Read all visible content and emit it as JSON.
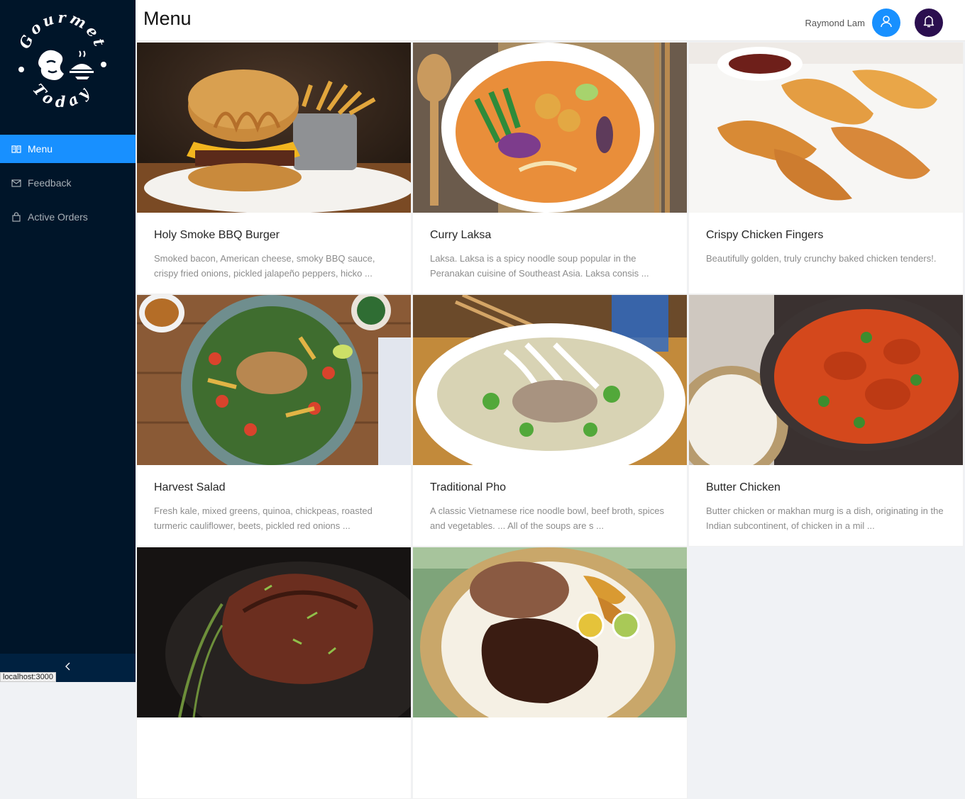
{
  "app": {
    "logo_text_top": "Gourmet",
    "logo_text_bottom": "Today",
    "status_url": "localhost:3000"
  },
  "sidebar": {
    "items": [
      {
        "label": "Menu",
        "icon": "book-icon",
        "active": true
      },
      {
        "label": "Feedback",
        "icon": "mail-icon",
        "active": false
      },
      {
        "label": "Active Orders",
        "icon": "shopping-bag-icon",
        "active": false
      }
    ],
    "collapse_icon": "chevron-left-icon"
  },
  "header": {
    "title": "Menu",
    "user_name": "Raymond Lam",
    "user_icon": "user-icon",
    "notification_icon": "bell-icon"
  },
  "menu_items": [
    {
      "title": "Holy Smoke BBQ Burger",
      "description": "Smoked bacon, American cheese, smoky BBQ sauce, crispy fried onions, pickled jalapeño peppers, hicko ..."
    },
    {
      "title": "Curry Laksa",
      "description": "Laksa. Laksa is a spicy noodle soup popular in the Peranakan cuisine of Southeast Asia. Laksa consis ..."
    },
    {
      "title": "Crispy Chicken Fingers",
      "description": "Beautifully golden, truly crunchy baked chicken tenders!."
    },
    {
      "title": "Harvest Salad",
      "description": "Fresh kale, mixed greens, quinoa, chickpeas, roasted turmeric cauliflower, beets, pickled red onions ..."
    },
    {
      "title": "Traditional Pho",
      "description": "A classic Vietnamese rice noodle bowl, beef broth, spices and vegetables. ... All of the soups are s ..."
    },
    {
      "title": "Butter Chicken",
      "description": "Butter chicken or makhan murg is a dish, originating in the Indian subcontinent, of chicken in a mil ..."
    },
    {
      "title": "",
      "description": ""
    },
    {
      "title": "",
      "description": ""
    }
  ],
  "colors": {
    "sidebar_bg": "#001529",
    "accent": "#1890ff",
    "bell_bg": "#2b0f4f",
    "page_bg": "#f0f2f5"
  }
}
